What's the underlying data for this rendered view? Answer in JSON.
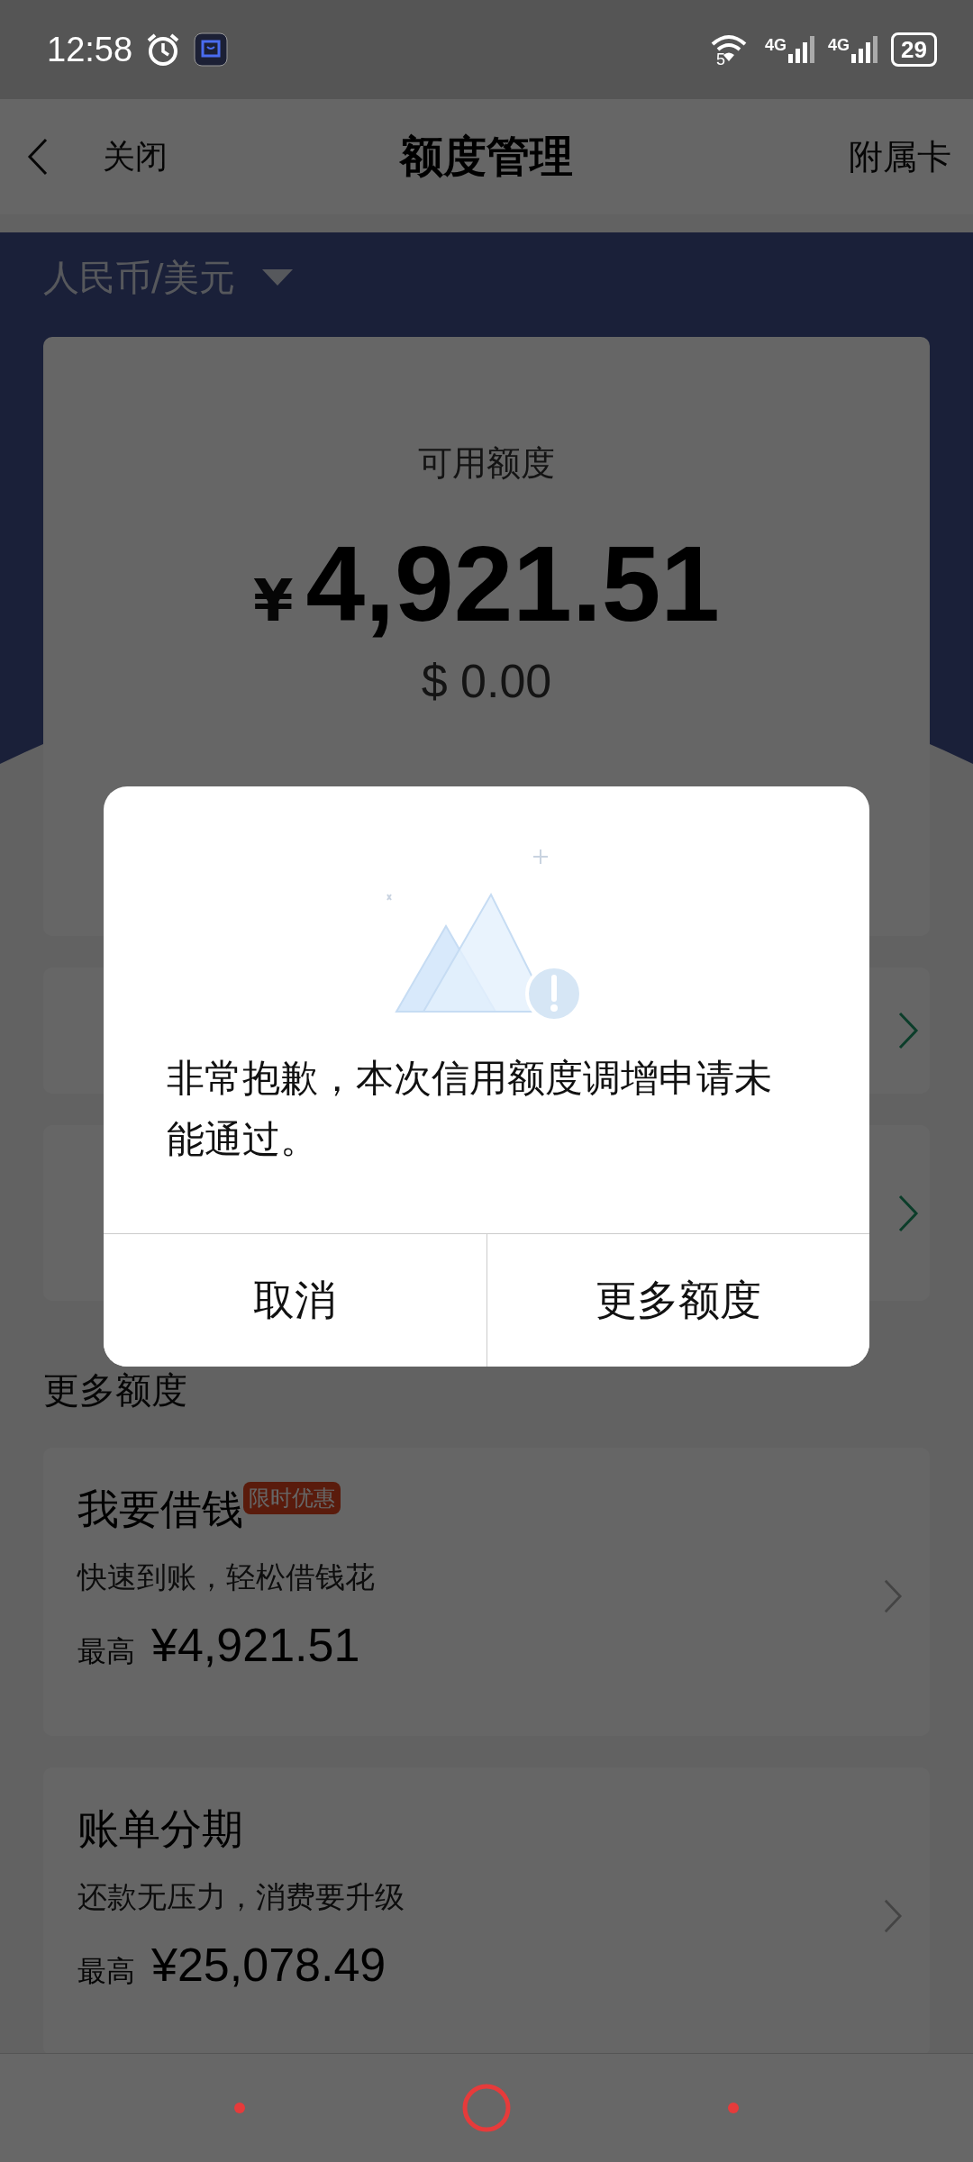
{
  "status_bar": {
    "time": "12:58",
    "wifi_badge": "5",
    "network_1": "4G",
    "network_2": "4G",
    "battery": "29"
  },
  "nav": {
    "close_label": "关闭",
    "title": "额度管理",
    "action": "附属卡"
  },
  "currency_selector": "人民币/美元",
  "balance": {
    "label": "可用额度",
    "currency_symbol": "¥",
    "amount": "4,921.51",
    "usd": "$ 0.00"
  },
  "section_title": "更多额度",
  "offers": [
    {
      "title": "我要借钱",
      "badge": "限时优惠",
      "subtitle": "快速到账，轻松借钱花",
      "prefix": "最高",
      "amount": "¥4,921.51"
    },
    {
      "title": "账单分期",
      "subtitle": "还款无压力，消费要升级",
      "prefix": "最高",
      "amount": "¥25,078.49"
    }
  ],
  "dialog": {
    "message": "非常抱歉，本次信用额度调增申请未能通过。",
    "buttons": [
      "取消",
      "更多额度"
    ]
  }
}
